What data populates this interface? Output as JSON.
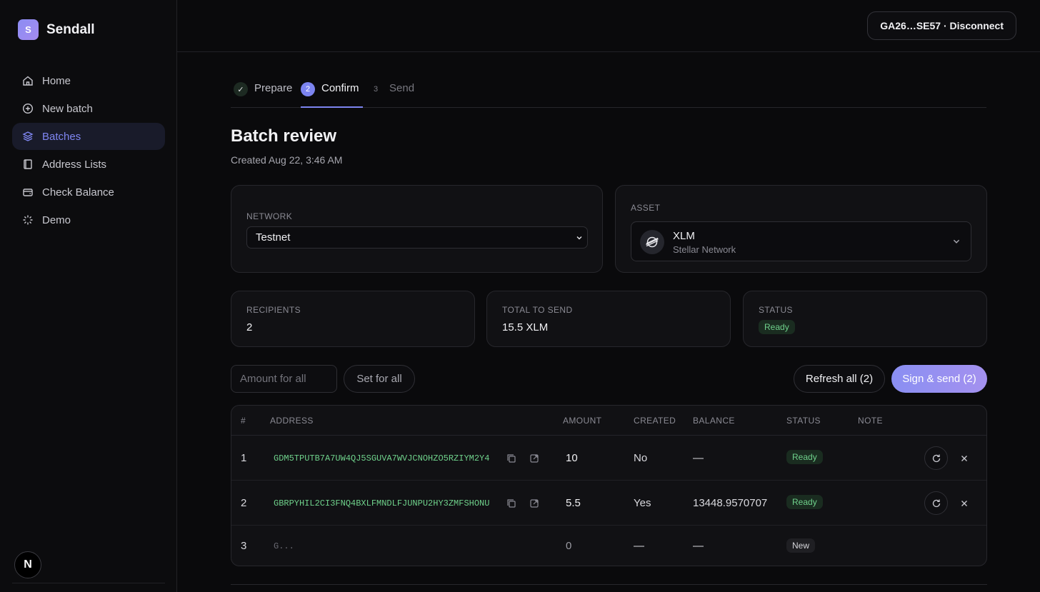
{
  "brand": {
    "logo_letter": "S",
    "name": "Sendall"
  },
  "nav": [
    {
      "label": "Home",
      "icon": "home-icon"
    },
    {
      "label": "New batch",
      "icon": "plus-circle-icon"
    },
    {
      "label": "Batches",
      "icon": "layers-icon",
      "active": true
    },
    {
      "label": "Address Lists",
      "icon": "book-icon"
    },
    {
      "label": "Check Balance",
      "icon": "wallet-icon"
    },
    {
      "label": "Demo",
      "icon": "sparkle-icon"
    }
  ],
  "footer_avatar": "N",
  "wallet": {
    "label": "GA26…SE57 · Disconnect"
  },
  "steps": [
    {
      "badge": "✓",
      "label": "Prepare",
      "state": "done"
    },
    {
      "badge": "2",
      "label": "Confirm",
      "state": "active"
    },
    {
      "badge": "3",
      "label": "Send",
      "state": "pending"
    }
  ],
  "page": {
    "title": "Batch review",
    "subtitle": "Created Aug 22, 3:46 AM"
  },
  "network": {
    "label": "Network",
    "value": "Testnet"
  },
  "asset": {
    "label": "Asset",
    "code": "XLM",
    "network": "Stellar Network"
  },
  "stats": {
    "recipients": {
      "label": "Recipients",
      "value": "2"
    },
    "total": {
      "label": "Total to send",
      "value": "15.5 XLM"
    },
    "status": {
      "label": "Status",
      "value": "Ready"
    }
  },
  "controls": {
    "amount_placeholder": "Amount for all",
    "set_all_label": "Set for all",
    "refresh_label": "Refresh all (2)",
    "sign_label": "Sign & send (2)"
  },
  "table": {
    "headers": {
      "num": "#",
      "address": "Address",
      "amount": "Amount",
      "created": "Created",
      "balance": "Balance",
      "status": "Status",
      "note": "Note"
    },
    "rows": [
      {
        "num": "1",
        "address": "GDM5TPUTB7A7UW4QJ5SGUVA7WVJCNOHZO5RZIYM2Y4",
        "amount": "10",
        "created": "No",
        "balance": "—",
        "status": "Ready"
      },
      {
        "num": "2",
        "address": "GBRPYHIL2CI3FNQ4BXLFMNDLFJUNPU2HY3ZMFSHONU",
        "amount": "5.5",
        "created": "Yes",
        "balance": "13448.9570707",
        "status": "Ready"
      },
      {
        "num": "3",
        "address": "G...",
        "amount": "0",
        "created": "—",
        "balance": "—",
        "status": "New"
      }
    ]
  },
  "colors": {
    "accent": "#7c84f0",
    "success": "#6fd18b",
    "background": "#0a0a0c"
  }
}
